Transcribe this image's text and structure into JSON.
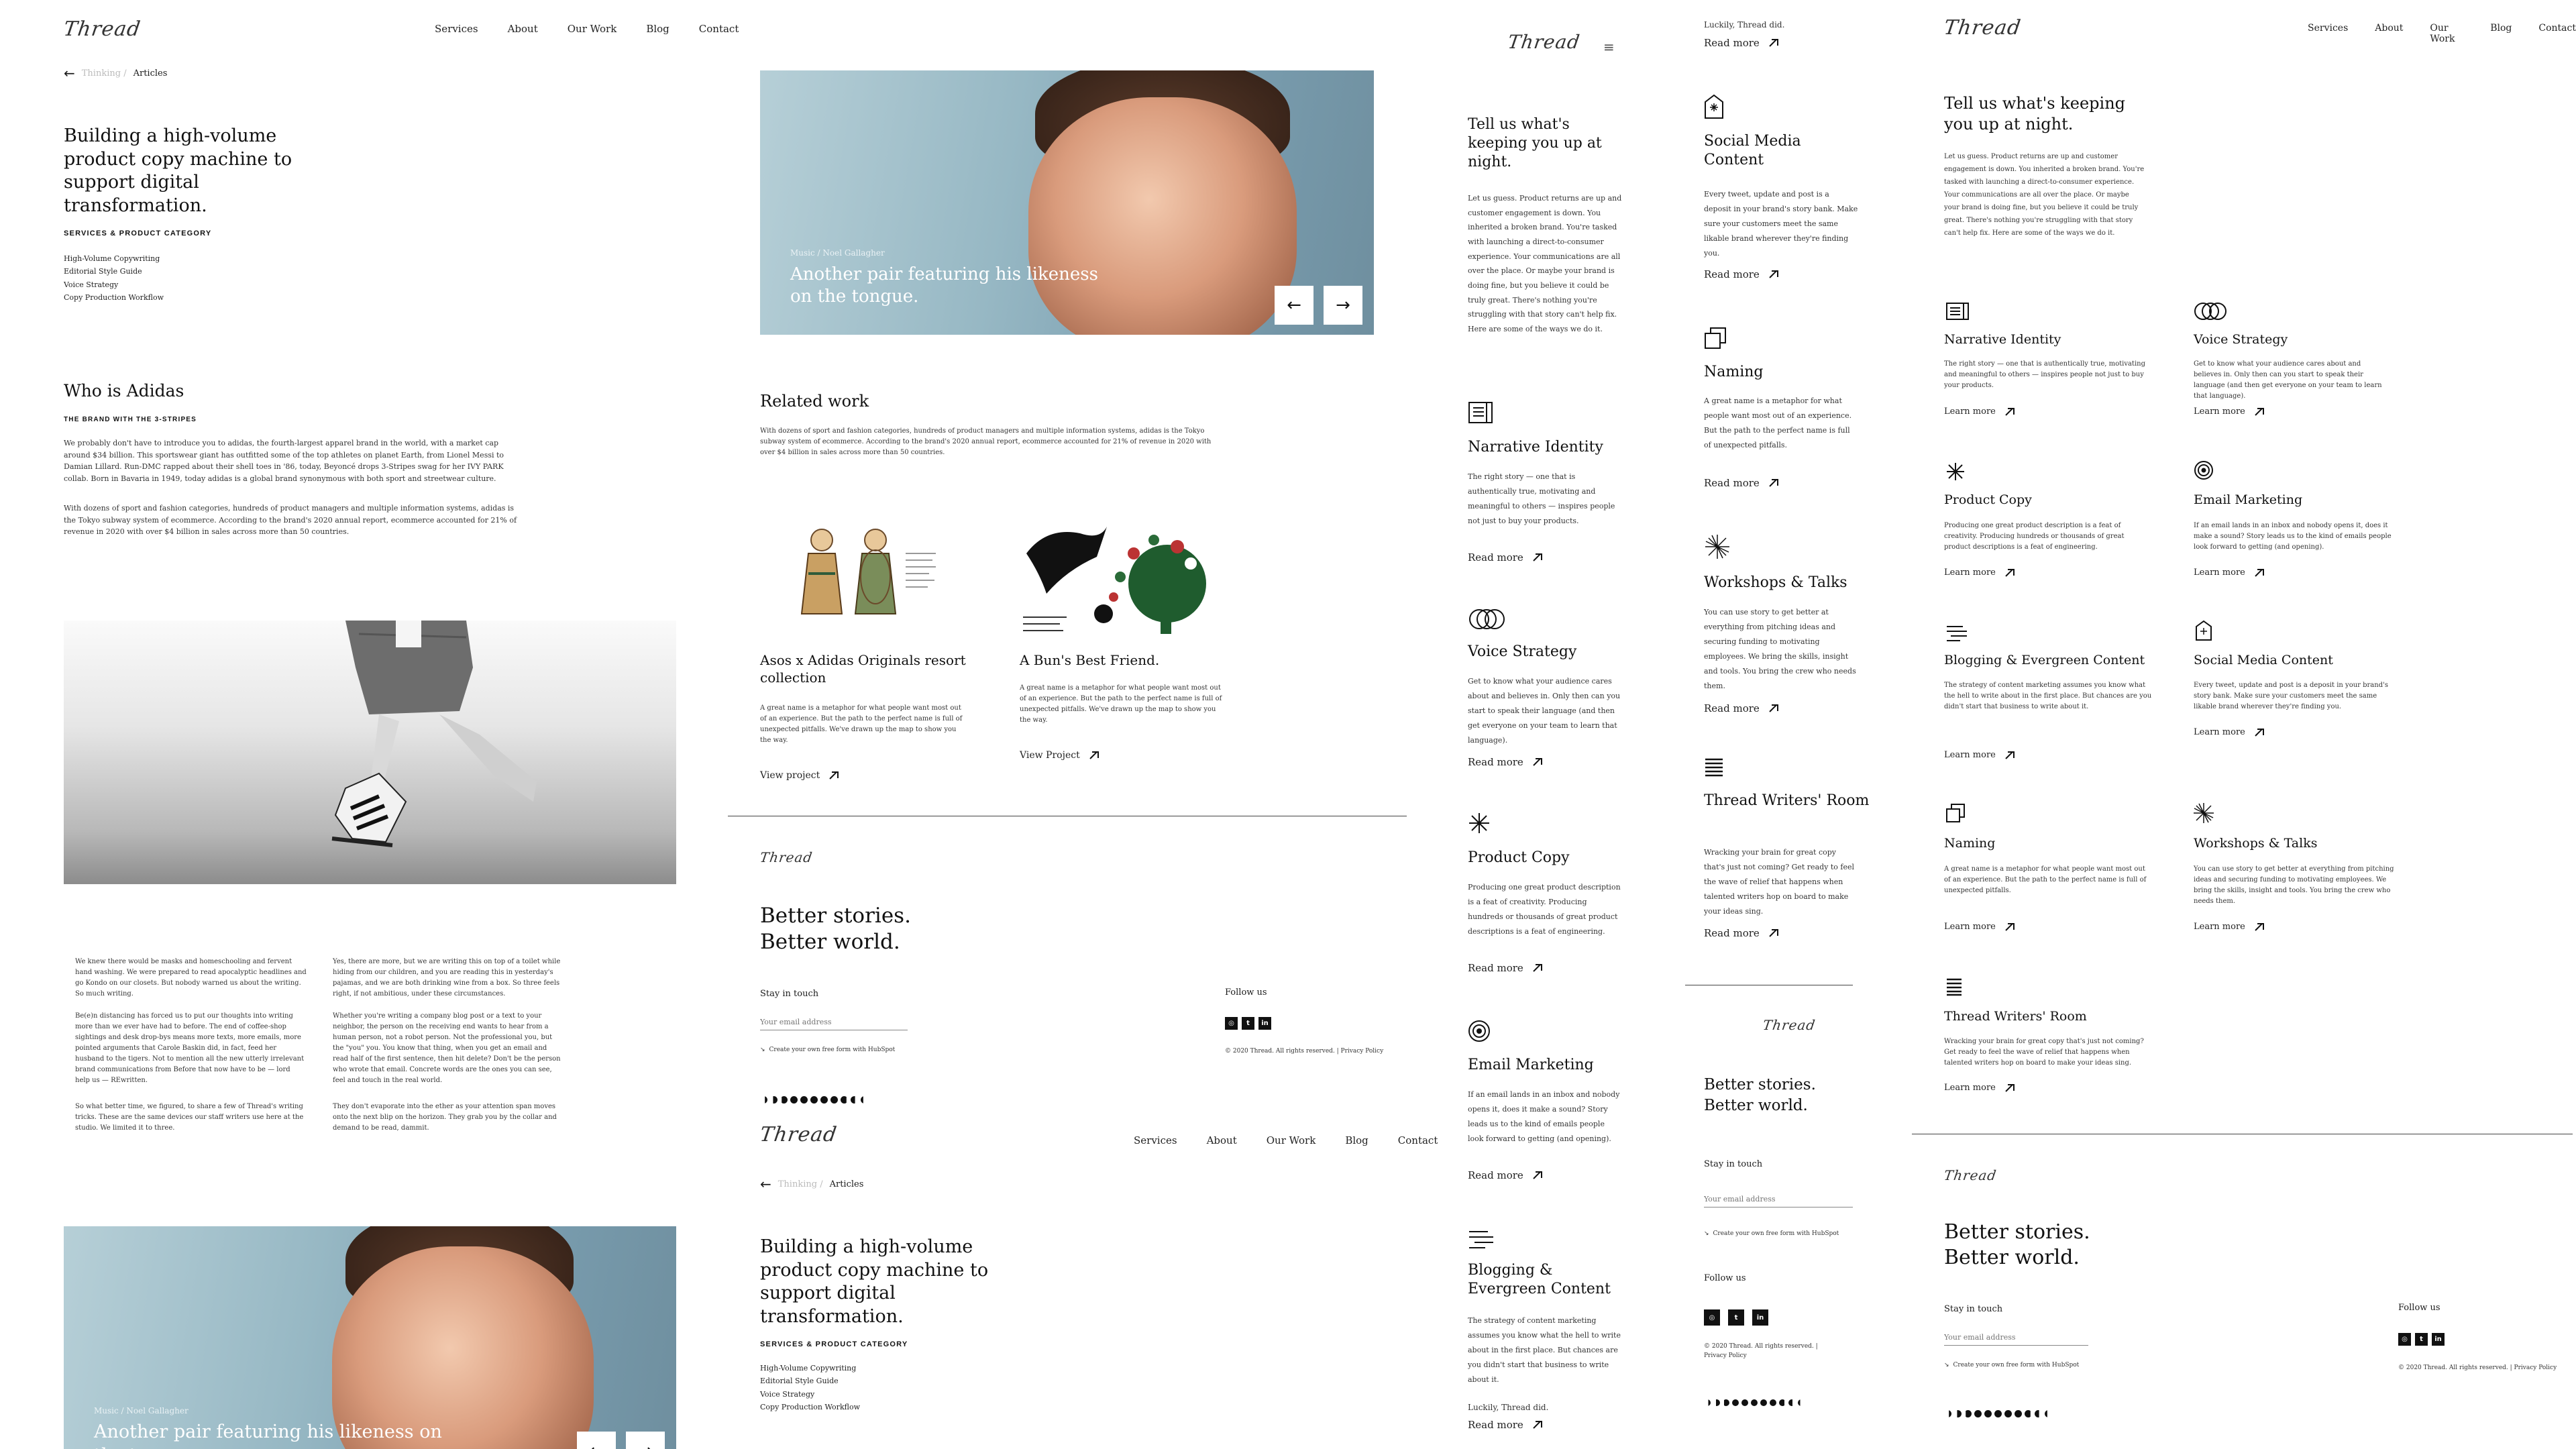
{
  "brand": {
    "logo": "Thread"
  },
  "nav": {
    "services": "Services",
    "about": "About",
    "our_work": "Our Work",
    "blog": "Blog",
    "contact": "Contact"
  },
  "breadcrumb": {
    "parent": "Thinking /",
    "current": "Articles"
  },
  "article": {
    "title": "Building a high-volume product copy machine to support digital transformation.",
    "category_label": "SERVICES & PRODUCT CATEGORY",
    "categories": [
      "High-Volume Copywriting",
      "Editorial Style Guide",
      "Voice Strategy",
      "Copy Production Workflow"
    ],
    "who_heading": "Who is Adidas",
    "who_sub": "THE BRAND WITH THE 3-STRIPES",
    "who_p1": "We probably don't have to introduce you to adidas, the fourth-largest apparel brand in the world, with a market cap around $34 billion. This sportswear giant has outfitted some of the top athletes on planet Earth, from Lionel Messi to Damian Lillard. Run-DMC rapped about their shell toes in '86, today, Beyoncé drops 3-Stripes swag for her IVY PARK collab. Born in Bavaria in 1949, today adidas is a global brand synonymous with both sport and streetwear culture.",
    "who_p2": "With dozens of sport and fashion categories, hundreds of product managers and multiple information systems, adidas is the Tokyo subway system of ecommerce. According to the brand's 2020 annual report, ecommerce accounted for 21% of revenue in 2020 with over $4 billion in sales across more than 50 countries.",
    "col1_p1": "We knew there would be masks and homeschooling and fervent hand washing. We were prepared to read apocalyptic headlines and go Kondo on our closets. But nobody warned us about the writing. So much writing.",
    "col1_p2": "Be(e)n distancing has forced us to put our thoughts into writing more than we ever have had to before. The end of coffee-shop sightings and desk drop-bys means more texts, more emails, more pointed arguments that Carole Baskin did, in fact, feed her husband to the tigers. Not to mention all the new utterly irrelevant brand communications from Before that now have to be — lord help us — REwritten.",
    "col1_p3": "So what better time, we figured, to share a few of Thread's writing tricks. These are the same devices our staff writers use here at the studio. We limited it to three.",
    "col2_p1": "Yes, there are more, but we are writing this on top of a toilet while hiding from our children, and you are reading this in yesterday's pajamas, and we are both drinking wine from a box. So three feels right, if not ambitious, under these circumstances.",
    "col2_p2": "Whether you're writing a company blog post or a text to your neighbor, the person on the receiving end wants to hear from a human person, not a robot person. Not the professional you, but the \"you\" you. You know that thing, when you get an email and read half of the first sentence, then hit delete? Don't be the person who wrote that email. Concrete words are the ones you can see, feel and touch in the real world.",
    "col2_p3": "They don't evaporate into the ether as your attention span moves onto the next blip on the horizon. They grab you by the collar and demand to be read, dammit."
  },
  "hero": {
    "caption": "Music / Noel Gallagher",
    "title": "Another pair featuring his likeness on the tongue."
  },
  "related": {
    "heading": "Related work",
    "intro": "With dozens of sport and fashion categories, hundreds of product managers and multiple information systems, adidas is the Tokyo subway system of ecommerce. According to the brand's 2020 annual report, ecommerce accounted for 21% of revenue in 2020 with over $4 billion in sales across more than 50 countries.",
    "items": [
      {
        "title": "Asos x Adidas Originals resort collection",
        "desc": "A great name is a metaphor for what people want most out of an experience. But the path to the perfect name is full of unexpected pitfalls. We've drawn up the map to show you the way.",
        "link": "View project"
      },
      {
        "title": "A Bun's Best Friend.",
        "desc": "A great name is a metaphor for what people want most out of an experience. But the path to the perfect name is full of unexpected pitfalls. We've drawn up the map to show you the way.",
        "link": "View Project"
      }
    ]
  },
  "footer": {
    "tagline_1": "Better stories.",
    "tagline_2": "Better world.",
    "stay": "Stay in touch",
    "email_placeholder": "Your email address",
    "hubspot": "Create your own free form with HubSpot",
    "follow": "Follow us",
    "copyright": "© 2020 Thread. All rights reserved. | Privacy Policy",
    "copyright_a": "© 2020 Thread. All rights reserved. |",
    "copyright_b": "Privacy Policy"
  },
  "services": {
    "intro_heading": "Tell us what's keeping you up at night.",
    "intro_body": "Let us guess. Product returns are up and customer engagement is down. You inherited a broken brand. You're tasked with launching a direct-to-consumer experience. Your communications are all over the place. Or maybe your brand is doing fine, but you believe it could be truly great. There's nothing you're struggling with that story can't help fix. Here are some of the ways we do it.",
    "learn_more": "Learn more",
    "read_more": "Read more",
    "luckily": "Luckily, Thread did.",
    "items": [
      {
        "name": "Narrative Identity",
        "desc": "The right story — one that is authentically true, motivating and meaningful to others — inspires people not just to buy your products."
      },
      {
        "name": "Voice Strategy",
        "desc": "Get to know what your audience cares about and believes in. Only then can you start to speak their language (and then get everyone on your team to learn that language)."
      },
      {
        "name": "Product Copy",
        "desc": "Producing one great product description is a feat of creativity. Producing hundreds or thousands of great product descriptions is a feat of engineering."
      },
      {
        "name": "Email Marketing",
        "desc": "If an email lands in an inbox and nobody opens it, does it make a sound? Story leads us to the kind of emails people look forward to getting (and opening)."
      },
      {
        "name": "Blogging & Evergreen Content",
        "desc": "The strategy of content marketing assumes you know what the hell to write about in the first place. But chances are you didn't start that business to write about it."
      },
      {
        "name": "Social Media Content",
        "desc": "Every tweet, update and post is a deposit in your brand's story bank. Make sure your customers meet the same likable brand wherever they're finding you."
      },
      {
        "name": "Naming",
        "desc": "A great name is a metaphor for what people want most out of an experience. But the path to the perfect name is full of unexpected pitfalls."
      },
      {
        "name": "Workshops & Talks",
        "desc": "You can use story to get better at everything from pitching ideas and securing funding to motivating employees. We bring the skills, insight and tools. You bring the crew who needs them."
      },
      {
        "name": "Thread Writers' Room",
        "desc": "Wracking your brain for great copy that's just not coming? Get ready to feel the wave of relief that happens when talented writers hop on board to make your ideas sing."
      }
    ]
  }
}
